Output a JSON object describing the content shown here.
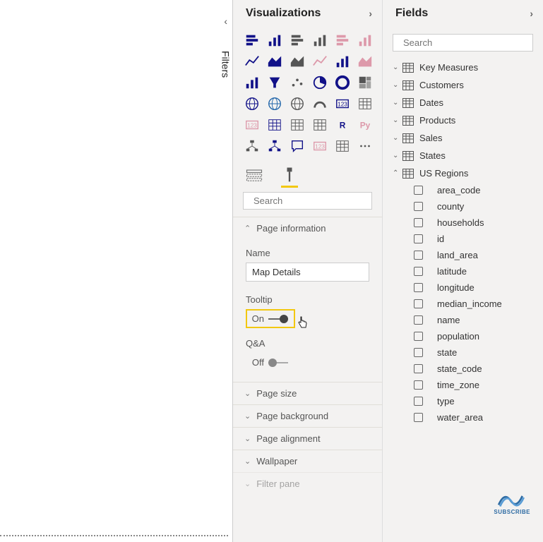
{
  "filters_collapsed_label": "Filters",
  "viz": {
    "title": "Visualizations",
    "search_placeholder": "Search",
    "tabs": {
      "fields": "fields-icon",
      "format": "format-icon"
    },
    "icons": [
      "stacked-bar",
      "clustered-bar",
      "stacked-col",
      "clustered-col",
      "hundred-bar",
      "hundred-col",
      "line",
      "area",
      "stacked-area",
      "line-col",
      "line-col-2",
      "ribbon",
      "waterfall",
      "funnel",
      "scatter",
      "pie",
      "donut",
      "treemap",
      "map",
      "filled-map",
      "shape-map",
      "gauge",
      "card",
      "multi-card",
      "kpi",
      "slicer",
      "table",
      "matrix",
      "r-visual",
      "python-visual",
      "key-influencers",
      "decomp-tree",
      "qa-visual",
      "narrative",
      "paginated",
      "more"
    ],
    "sections": {
      "page_info": {
        "title": "Page information",
        "name_label": "Name",
        "name_value": "Map Details",
        "tooltip_label": "Tooltip",
        "tooltip_state": "On",
        "qa_label": "Q&A",
        "qa_state": "Off"
      },
      "page_size": "Page size",
      "page_bg": "Page background",
      "page_align": "Page alignment",
      "wallpaper": "Wallpaper",
      "filter_pane": "Filter pane"
    }
  },
  "fields": {
    "title": "Fields",
    "search_placeholder": "Search",
    "tables": [
      {
        "name": "Key Measures",
        "expanded": false
      },
      {
        "name": "Customers",
        "expanded": false
      },
      {
        "name": "Dates",
        "expanded": false
      },
      {
        "name": "Products",
        "expanded": false
      },
      {
        "name": "Sales",
        "expanded": false
      },
      {
        "name": "States",
        "expanded": false
      },
      {
        "name": "US Regions",
        "expanded": true,
        "fields": [
          "area_code",
          "county",
          "households",
          "id",
          "land_area",
          "latitude",
          "longitude",
          "median_income",
          "name",
          "population",
          "state",
          "state_code",
          "time_zone",
          "type",
          "water_area"
        ]
      }
    ]
  },
  "subscribe": "SUBSCRIBE"
}
